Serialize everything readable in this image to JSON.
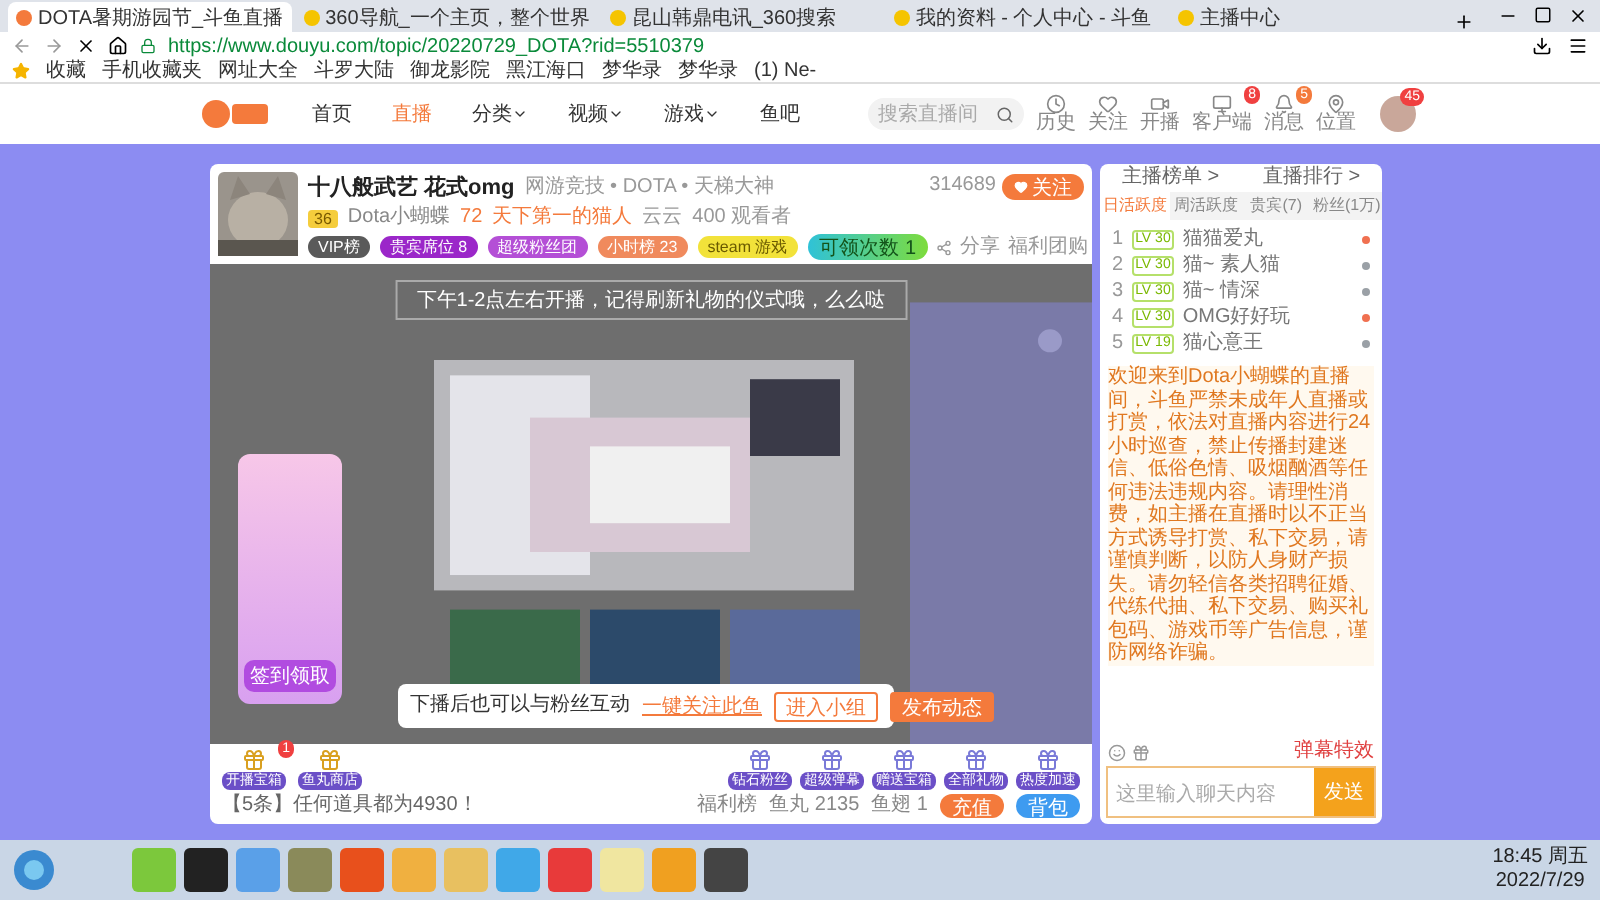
{
  "browser": {
    "tabs": [
      {
        "title": "DOTA暑期游园节_斗鱼直播",
        "selected": true
      },
      {
        "title": "360导航_一个主页，整个世界",
        "selected": false
      },
      {
        "title": "昆山韩鼎电讯_360搜索",
        "selected": false
      },
      {
        "title": "我的资料 - 个人中心 - 斗鱼",
        "selected": false
      },
      {
        "title": "主播中心",
        "selected": false
      }
    ],
    "url": "https://www.douyu.com/topic/20220729_DOTA?rid=5510379",
    "bookmarks": [
      "收藏",
      "手机收藏夹",
      "网址大全",
      "斗罗大陆",
      "御龙影院",
      "黑江海口",
      "梦华录",
      "梦华录",
      "(1) Ne-"
    ]
  },
  "site_header": {
    "nav": [
      {
        "label": "首页",
        "selected": false,
        "dropdown": false
      },
      {
        "label": "直播",
        "selected": true,
        "dropdown": false
      },
      {
        "label": "分类",
        "selected": false,
        "dropdown": true
      },
      {
        "label": "视频",
        "selected": false,
        "dropdown": true
      },
      {
        "label": "游戏",
        "selected": false,
        "dropdown": true
      },
      {
        "label": "鱼吧",
        "selected": false,
        "dropdown": false
      }
    ],
    "search": {
      "placeholder": "搜索直播间"
    },
    "tools": [
      {
        "kind": "history",
        "label": "历史"
      },
      {
        "kind": "follow",
        "label": "关注"
      },
      {
        "kind": "live",
        "label": "开播"
      },
      {
        "kind": "client",
        "label": "客户端",
        "badge": "8"
      },
      {
        "kind": "message",
        "label": "消息",
        "badge": "5"
      },
      {
        "kind": "location",
        "label": "位置"
      }
    ],
    "avatar_badge": "45"
  },
  "streamer": {
    "title": "十八般武艺 花式omg",
    "breadcrumb": "网游竞技 • DOTA • 天梯大神",
    "level": "36",
    "name": "Dota小蝴蝶",
    "heat": "72",
    "rank_tag": "天下第一的猫人",
    "tags": [
      "云云",
      "400 观看者"
    ],
    "badges": [
      {
        "label": "VIP榜",
        "color": "#5a5a5a"
      },
      {
        "label": "贵宾席位 8",
        "color": "#9b27c9"
      },
      {
        "label": "超级粉丝团",
        "color": "#b44fd6"
      },
      {
        "label": "小时榜 23",
        "color": "#f08a5d"
      },
      {
        "label": "steam 游戏",
        "color": "#f2e23a"
      }
    ],
    "followers": "314689",
    "follow_button": "关注",
    "claim": {
      "label": "可领次数",
      "count": "1"
    },
    "actions": [
      "分享",
      "福利团购"
    ]
  },
  "video": {
    "banner": "下午1-2点左右开播，记得刷新礼物的仪式哦，么么哒",
    "promo": "签到领取",
    "popup": {
      "text": "下播后也可以与粉丝互动",
      "link": "一键关注此鱼",
      "buttons": [
        {
          "label": "进入小组",
          "primary": false
        },
        {
          "label": "发布动态",
          "primary": true
        }
      ]
    }
  },
  "gift_bar": {
    "left": [
      {
        "label": "开播宝箱",
        "badge": "1"
      },
      {
        "label": "鱼丸商店"
      }
    ],
    "right": [
      {
        "label": "钻石粉丝"
      },
      {
        "label": "超级弹幕"
      },
      {
        "label": "赠送宝箱"
      },
      {
        "label": "全部礼物"
      },
      {
        "label": "热度加速"
      }
    ],
    "notice": "【5条】任何道具都为4930！",
    "stats": [
      "福利榜",
      "鱼丸 2135",
      "鱼翅 1"
    ],
    "buttons": [
      {
        "label": "充值",
        "color": "#f47a3c"
      },
      {
        "label": "背包",
        "color": "#3e9bf0"
      }
    ]
  },
  "chat": {
    "boards": [
      "主播榜单 >",
      "直播排行 >"
    ],
    "tabs": [
      {
        "label": "日活跃度",
        "selected": true
      },
      {
        "label": "周活跃度",
        "selected": false
      },
      {
        "label": "贵宾(7)",
        "selected": false
      },
      {
        "label": "粉丝(1万)",
        "selected": false
      }
    ],
    "ranks": [
      {
        "rank": "1",
        "level": "LV 30",
        "name": "猫猫爱丸",
        "color": "#f07050"
      },
      {
        "rank": "2",
        "level": "LV 30",
        "name": "猫~ 素人猫",
        "color": "#9aa0a6"
      },
      {
        "rank": "3",
        "level": "LV 30",
        "name": "猫~ 情深",
        "color": "#9aa0a6"
      },
      {
        "rank": "4",
        "level": "LV 30",
        "name": "OMG好好玩",
        "color": "#f07050"
      },
      {
        "rank": "5",
        "level": "LV 19",
        "name": "猫心意王",
        "color": "#9aa0a6"
      }
    ],
    "notice": "欢迎来到Dota小蝴蝶的直播间，斗鱼严禁未成年人直播或打赏，依法对直播内容进行24小时巡查，禁止传播封建迷信、低俗色情、吸烟酗酒等任何违法违规内容。请理性消费，如主播在直播时以不正当方式诱导打赏、私下交易，请谨慎判断，以防人身财产损失。请勿轻信各类招聘征婚、代练代抽、私下交易、购买礼包码、游戏币等广告信息，谨防网络诈骗。",
    "effects": "弹幕特效",
    "input": {
      "placeholder": "这里输入聊天内容"
    },
    "send": "发送"
  },
  "taskbar": {
    "time": "18:45 周五",
    "date": "2022/7/29"
  }
}
